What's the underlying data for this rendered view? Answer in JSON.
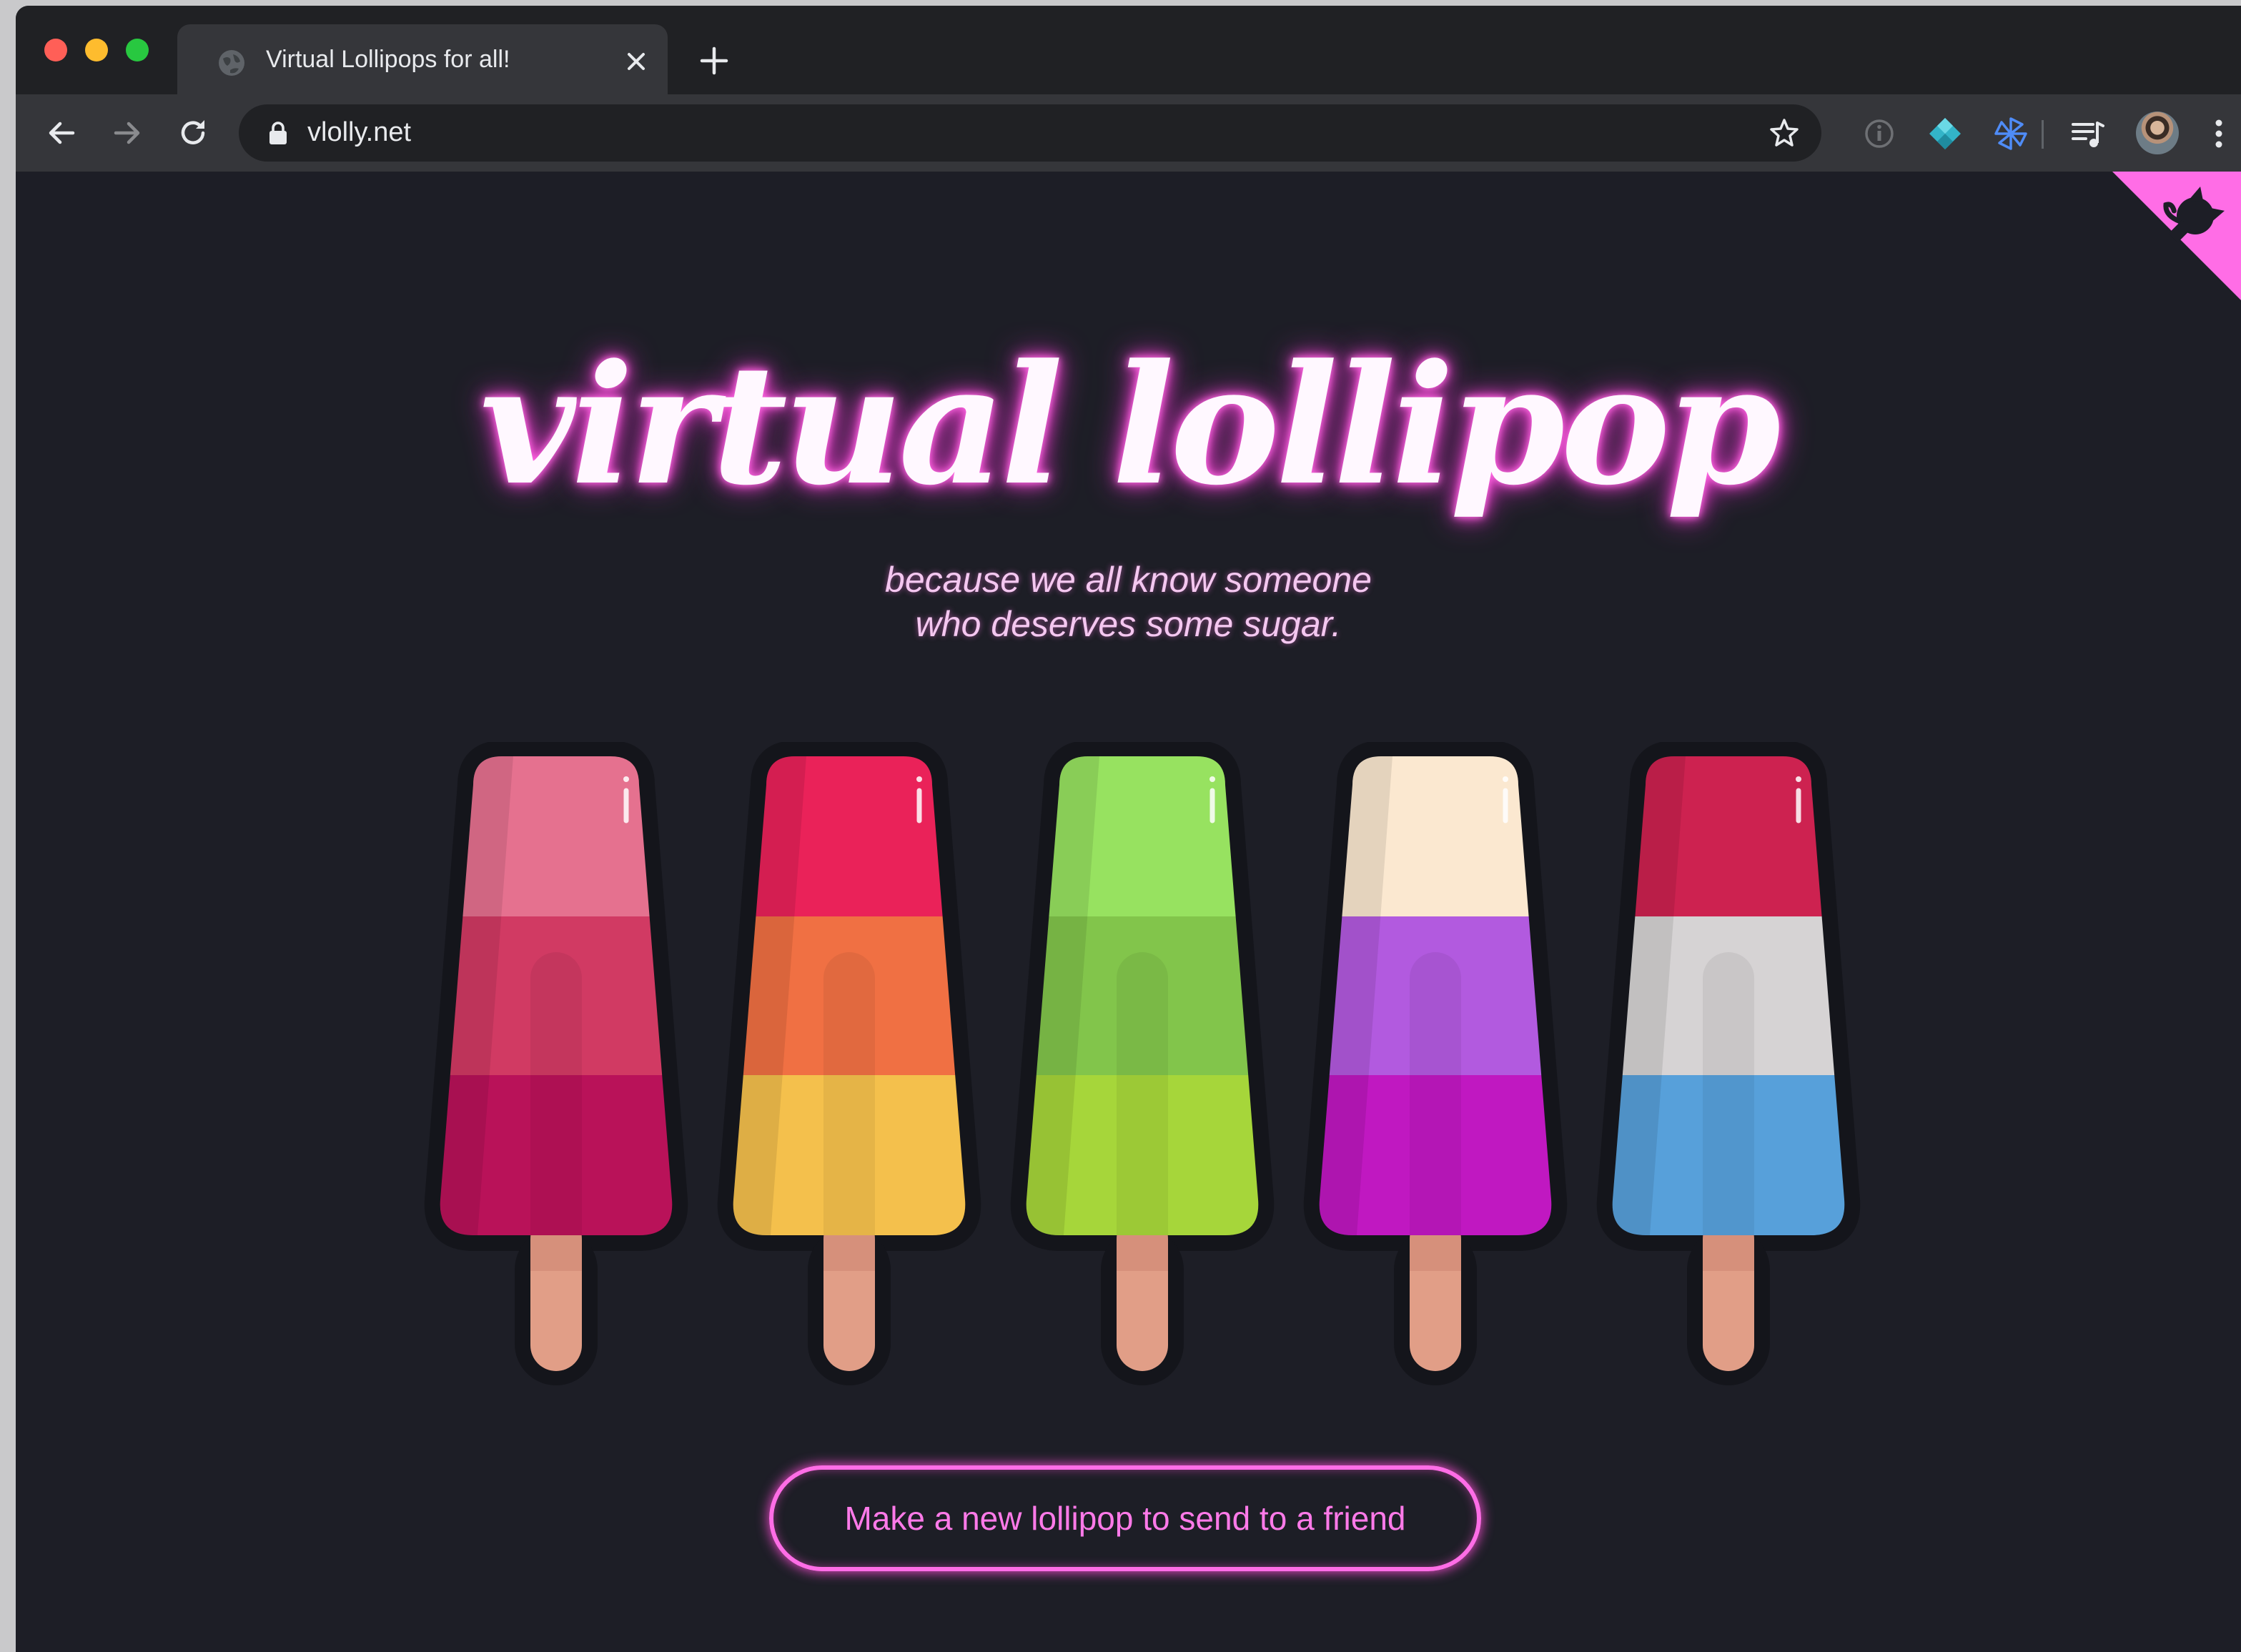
{
  "browser": {
    "tab": {
      "title": "Virtual Lollipops for all!"
    },
    "address_bar": {
      "url": "vlolly.net"
    }
  },
  "page": {
    "logo_text": "virtual lollipop",
    "subtitle_line1": "because we all know someone",
    "subtitle_line2": "who deserves some sugar.",
    "cta_label": "Make a new lollipop to send to a friend",
    "accent_color": "#ff6de6",
    "background_color": "#1d1e26"
  },
  "lollipops": [
    {
      "top": "#e5718f",
      "middle": "#d13a63",
      "bottom": "#b91259"
    },
    {
      "top": "#ea2259",
      "middle": "#f07043",
      "bottom": "#f4c04c"
    },
    {
      "top": "#97e260",
      "middle": "#82c54b",
      "bottom": "#a6d63a"
    },
    {
      "top": "#fbe8d0",
      "middle": "#b25adf",
      "bottom": "#c018c1"
    },
    {
      "top": "#cd2250",
      "middle": "#d6d3d4",
      "bottom": "#57a0da"
    }
  ],
  "icons": {
    "tab": "globe-icon",
    "close": "close-icon",
    "new_tab": "plus-icon",
    "back": "back-arrow-icon",
    "forward": "forward-arrow-icon",
    "reload": "reload-icon",
    "secure": "lock-icon",
    "bookmark": "star-icon",
    "extensions": [
      "info-icon",
      "diamond-extension-icon",
      "pinwheel-extension-icon",
      "media-queue-icon"
    ],
    "menu": "kebab-menu-icon",
    "corner": "github-octocat-icon"
  }
}
